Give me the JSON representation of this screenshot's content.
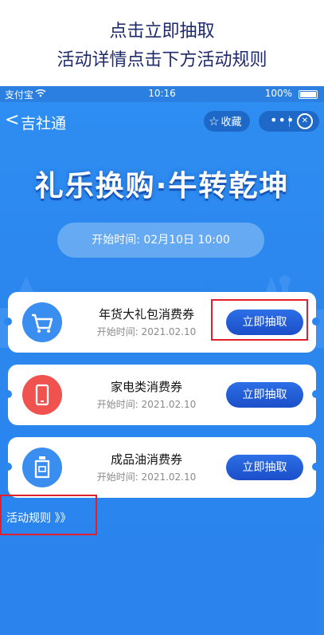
{
  "caption": {
    "line1": "点击立即抽取",
    "line2": "活动详情点击下方活动规则"
  },
  "status_bar": {
    "carrier": "支付宝",
    "time": "10:16",
    "battery": "100%"
  },
  "navbar": {
    "back_glyph": "<",
    "title": "吉社通",
    "favorite_label": "收藏",
    "more_glyph": "•••",
    "close_glyph": "✕"
  },
  "banner": {
    "title": "礼乐换购·牛转乾坤",
    "start_time": "开始时间: 02月10日 10:00"
  },
  "coupons": [
    {
      "name": "年货大礼包消费券",
      "date": "开始时间: 2021.02.10",
      "button": "立即抽取",
      "icon": "cart-icon",
      "icon_color": "#3a8ef0"
    },
    {
      "name": "家电类消费券",
      "date": "开始时间: 2021.02.10",
      "button": "立即抽取",
      "icon": "phone-icon",
      "icon_color": "#f0524f"
    },
    {
      "name": "成品油消费券",
      "date": "开始时间: 2021.02.10",
      "button": "立即抽取",
      "icon": "oil-bottle-icon",
      "icon_color": "#3a8ef0"
    }
  ],
  "rules_link": "活动规则 》》",
  "colors": {
    "background": "#2b86ee",
    "button": "#1f5ed6",
    "highlight": "#e0202e",
    "caption": "#1f2a6b"
  }
}
